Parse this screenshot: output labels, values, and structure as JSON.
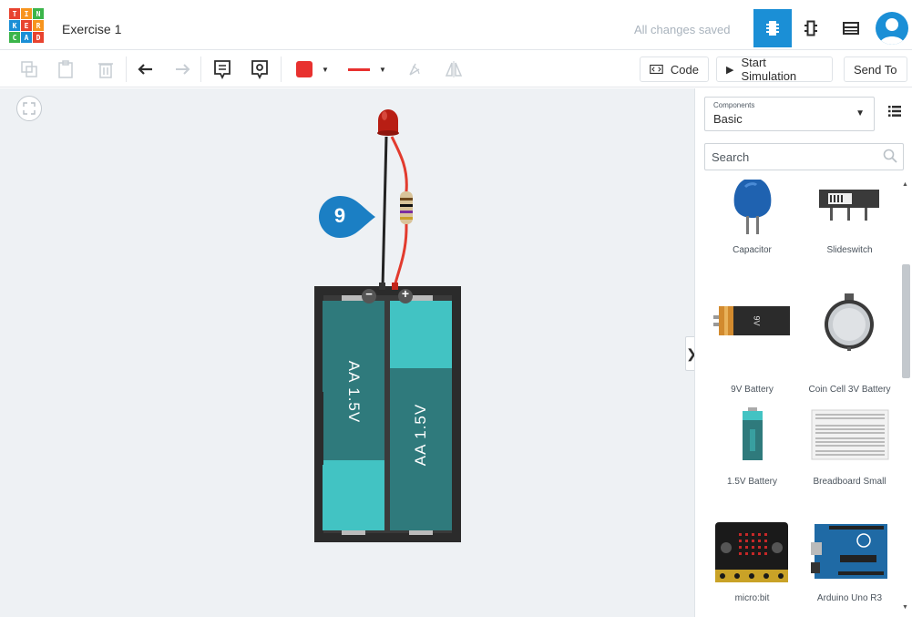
{
  "app": {
    "logo_letters": [
      "T",
      "I",
      "N",
      "K",
      "E",
      "R",
      "C",
      "A",
      "D"
    ],
    "logo_colors": [
      "#e8432f",
      "#f7941d",
      "#3bb54a",
      "#1b8fd6",
      "#e8432f",
      "#f7941d",
      "#3bb54a",
      "#1b8fd6",
      "#e8432f"
    ],
    "title": "Exercise 1",
    "save_status": "All changes saved",
    "accent": "#1b8fd6"
  },
  "toolbar": {
    "code_label": "Code",
    "simulate_label": "Start Simulation",
    "send_label": "Send To",
    "fill_color": "#e8312f",
    "wire_color": "#e8312f"
  },
  "sidebar": {
    "components_label": "Components",
    "components_value": "Basic",
    "search_placeholder": "Search",
    "items": [
      {
        "name": "Capacitor",
        "icon": "capacitor-icon"
      },
      {
        "name": "Slideswitch",
        "icon": "slideswitch-icon"
      },
      {
        "name": "9V Battery",
        "icon": "battery-9v-icon"
      },
      {
        "name": "Coin Cell 3V Battery",
        "icon": "coin-cell-icon"
      },
      {
        "name": "1.5V Battery",
        "icon": "battery-aa-icon"
      },
      {
        "name": "Breadboard Small",
        "icon": "breadboard-icon"
      },
      {
        "name": "micro:bit",
        "icon": "microbit-icon"
      },
      {
        "name": "Arduino Uno R3",
        "icon": "arduino-icon"
      }
    ]
  },
  "canvas": {
    "badge_number": "9",
    "battery_left_label": "AA 1.5V",
    "battery_right_label": "AA 1.5V",
    "battery_body_color": "#2f7a7c",
    "battery_cap_color": "#42c3c3",
    "terminal_minus": "−",
    "terminal_plus": "+",
    "nine_v_label": "9V"
  }
}
